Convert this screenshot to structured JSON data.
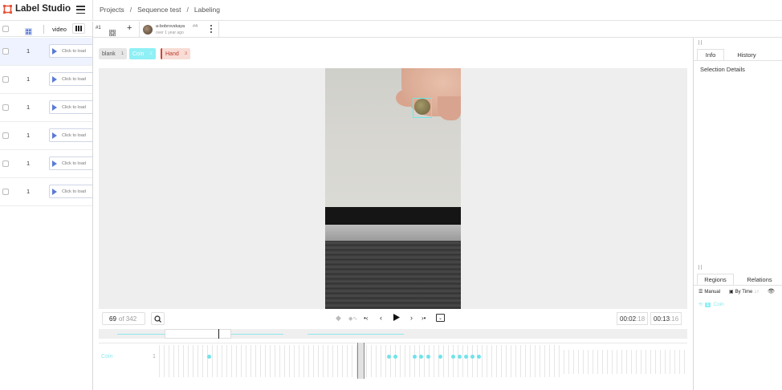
{
  "app": {
    "name": "Label Studio",
    "brand_color": "#e8573d"
  },
  "breadcrumb": {
    "projects": "Projects",
    "sep1": "/",
    "project": "Sequence test",
    "sep2": "/",
    "page": "Labeling"
  },
  "datamanager": {
    "column_video": "video",
    "rows": [
      {
        "id": "1",
        "video_text": "Click to load"
      },
      {
        "id": "1",
        "video_text": "Click to load"
      },
      {
        "id": "1",
        "video_text": "Click to load"
      },
      {
        "id": "1",
        "video_text": "Click to load"
      },
      {
        "id": "1",
        "video_text": "Click to load"
      },
      {
        "id": "1",
        "video_text": "Click to load"
      }
    ]
  },
  "annotation": {
    "number": "#1",
    "user": "a-bobrovskaya",
    "user_id": "#4",
    "time": "over 1 year ago"
  },
  "labels": [
    {
      "name": "blank",
      "hotkey": "1",
      "bg": "#e6e6e6",
      "fg": "#555"
    },
    {
      "name": "Coin",
      "hotkey": "2",
      "bg": "#8ff0f5",
      "fg": "#ffffff"
    },
    {
      "name": "Hand",
      "hotkey": "3",
      "bg": "#f8dcd6",
      "fg": "#c0392b"
    }
  ],
  "player": {
    "frame": "69",
    "of_total": "of 342",
    "current_time": "00:02",
    "current_ms": ":18",
    "total_time": "00:13",
    "total_ms": ":16",
    "progress": 0.2
  },
  "timeline": {
    "label": "Coin",
    "count": "1"
  },
  "right_panel": {
    "tab_info": "Info",
    "tab_history": "History",
    "selection_details": "Selection Details",
    "tab_regions": "Regions",
    "tab_relations": "Relations",
    "manual": "Manual",
    "by_time": "By Time",
    "region_label": "Coin",
    "region_index": "1"
  }
}
